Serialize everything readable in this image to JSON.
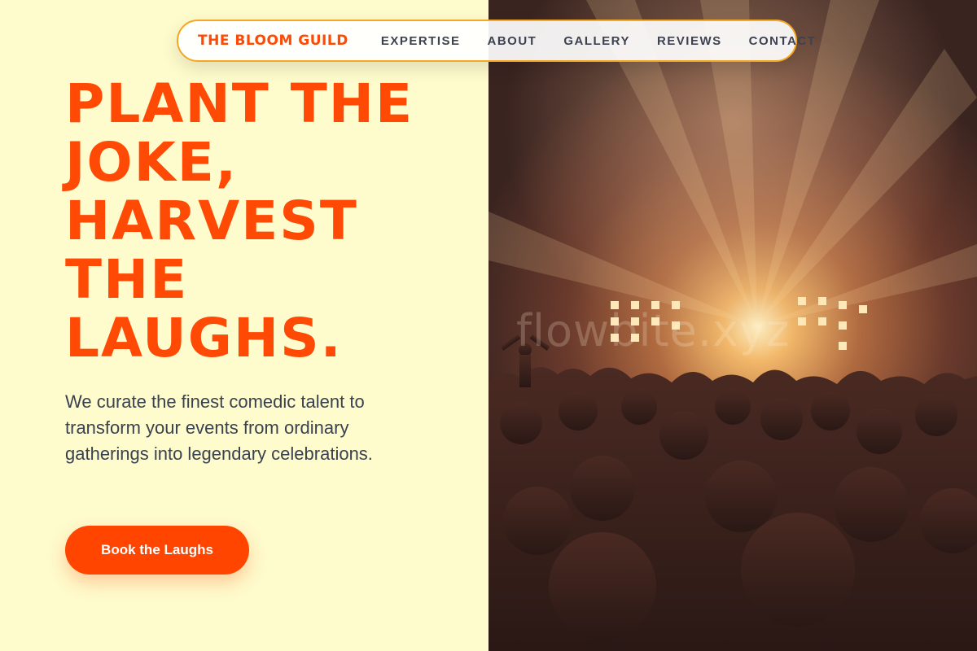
{
  "nav": {
    "brand": "THE BLOOM GUILD",
    "links": [
      "EXPERTISE",
      "ABOUT",
      "GALLERY",
      "REVIEWS",
      "CONTACT"
    ]
  },
  "hero": {
    "title_lines": [
      "PLANT THE",
      "JOKE,",
      "HARVEST",
      "THE",
      "LAUGHS."
    ],
    "subtitle": "We curate the finest comedic talent to transform your events from ordinary gatherings into legendary celebrations.",
    "cta_label": "Book the Laughs"
  },
  "image": {
    "subject": "concert-crowd-photo",
    "watermark": "flowbite.xyz"
  },
  "colors": {
    "accent": "#ff4a06",
    "left_background": "#fefbcc",
    "nav_border": "#f5a623",
    "body_text": "#3a4250"
  }
}
